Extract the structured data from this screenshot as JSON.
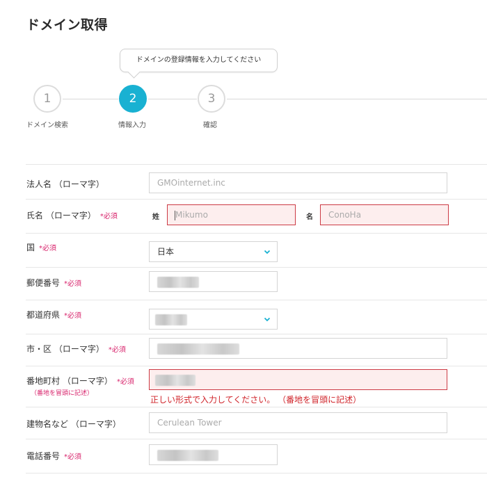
{
  "page": {
    "title": "ドメイン取得"
  },
  "tooltip": {
    "text": "ドメインの登録情報を入力してください"
  },
  "steps": [
    {
      "number": "1",
      "label": "ドメイン検索",
      "active": false
    },
    {
      "number": "2",
      "label": "情報入力",
      "active": true
    },
    {
      "number": "3",
      "label": "確認",
      "active": false
    }
  ],
  "required_mark": "*必須",
  "form": {
    "company": {
      "label": "法人名 （ローマ字）",
      "placeholder": "GMOinternet.inc"
    },
    "name": {
      "label": "氏名 （ローマ字）",
      "last_tag": "姓",
      "last_placeholder": "Mikumo",
      "first_tag": "名",
      "first_placeholder": "ConoHa"
    },
    "country": {
      "label": "国",
      "value": "日本"
    },
    "postal": {
      "label": "郵便番号"
    },
    "prefecture": {
      "label": "都道府県"
    },
    "city": {
      "label": "市・区 （ローマ字）"
    },
    "street": {
      "label": "番地町村 （ローマ字）",
      "note": "（番地を冒頭に記述）",
      "error": "正しい形式で入力してください。 （番地を冒頭に記述）"
    },
    "building": {
      "label": "建物名など （ローマ字）",
      "placeholder": "Cerulean Tower"
    },
    "phone": {
      "label": "電話番号"
    }
  },
  "colors": {
    "accent": "#19b1d2",
    "required": "#d8246c",
    "error": "#d0242a",
    "error_bg": "#fdeeee"
  }
}
